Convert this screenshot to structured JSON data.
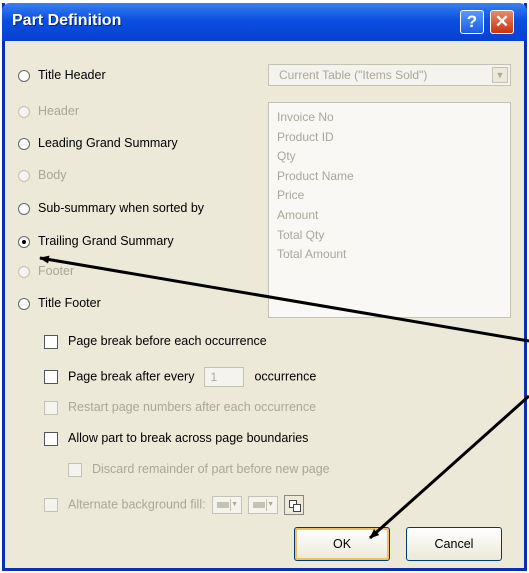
{
  "window": {
    "title": "Part Definition",
    "help_glyph": "?",
    "close_glyph": "✕"
  },
  "part_types": [
    {
      "label": "Title Header",
      "enabled": true,
      "selected": false
    },
    {
      "label": "Header",
      "enabled": false,
      "selected": false
    },
    {
      "label": "Leading Grand Summary",
      "enabled": true,
      "selected": false
    },
    {
      "label": "Body",
      "enabled": false,
      "selected": false
    },
    {
      "label": "Sub-summary when sorted by",
      "enabled": true,
      "selected": false
    },
    {
      "label": "Trailing Grand Summary",
      "enabled": true,
      "selected": true
    },
    {
      "label": "Footer",
      "enabled": false,
      "selected": false
    },
    {
      "label": "Title Footer",
      "enabled": true,
      "selected": false
    }
  ],
  "table_select": {
    "value": "Current Table (\"Items Sold\")"
  },
  "fields": [
    "Invoice No",
    "Product ID",
    "Qty",
    "Product Name",
    "Price",
    "Amount",
    "Total Qty",
    "Total Amount"
  ],
  "options": {
    "page_break_before": "Page break before each occurrence",
    "page_break_after_prefix": "Page break after every",
    "page_break_after_value": "1",
    "page_break_after_suffix": "occurrence",
    "restart_page_numbers": "Restart page numbers after each occurrence",
    "allow_break": "Allow part to break across page boundaries",
    "discard_remainder": "Discard remainder of part before new page",
    "alternate_background": "Alternate background fill:"
  },
  "buttons": {
    "ok": "OK",
    "cancel": "Cancel"
  },
  "colors": {
    "titlebar": "#0a4fe0",
    "dialog_bg": "#ece9d8",
    "disabled_text": "#a9a79a"
  }
}
